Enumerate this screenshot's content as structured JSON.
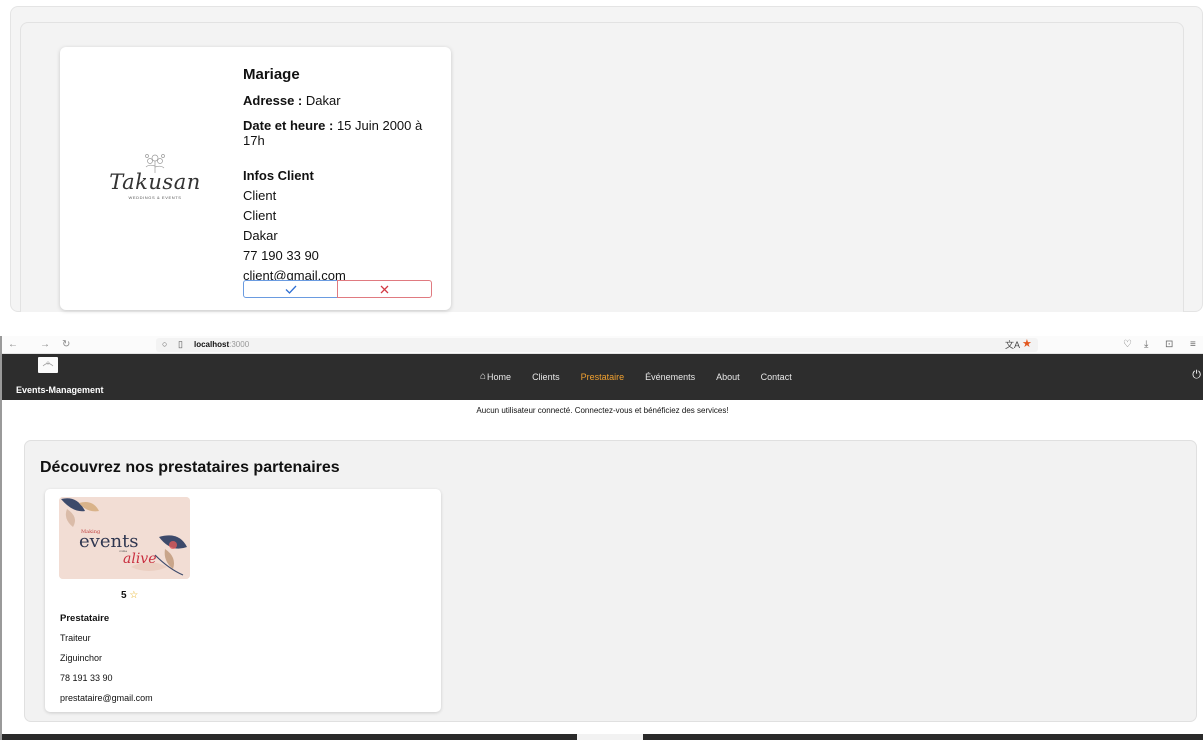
{
  "event_card": {
    "title": "Mariage",
    "address_label": "Adresse :",
    "address_value": "Dakar",
    "date_label": "Date et heure :",
    "date_value": "15 Juin 2000 à 17h",
    "client_section_title": "Infos Client",
    "client_first_name": "Client",
    "client_last_name": "Client",
    "client_city": "Dakar",
    "client_phone": "77 190 33 90",
    "client_email": "client@gmail.com",
    "accept_icon": "check-icon",
    "reject_icon": "close-icon",
    "logo_text": "Takusan",
    "logo_subtext": "WEDDINGS & EVENTS"
  },
  "browser": {
    "url_host": "localhost",
    "url_port": ":3000"
  },
  "header": {
    "brand": "Events-Management",
    "nav": {
      "home": "Home",
      "clients": "Clients",
      "providers": "Prestataire",
      "events": "Événements",
      "about": "About",
      "contact": "Contact"
    },
    "active_color": "#f0a030"
  },
  "notice": "Aucun utilisateur connecté. Connectez-vous et bénéficiez des services!",
  "main": {
    "heading": "Découvrez nos prestataires partenaires",
    "provider": {
      "image_text_1": "Making",
      "image_text_2": "events",
      "image_text_3": "alive",
      "image_text_4": "come",
      "rating": "5",
      "rating_icon": "star-icon",
      "name": "Prestataire",
      "service": "Traiteur",
      "city": "Ziguinchor",
      "phone": "78 191 33 90",
      "email": "prestataire@gmail.com"
    }
  }
}
